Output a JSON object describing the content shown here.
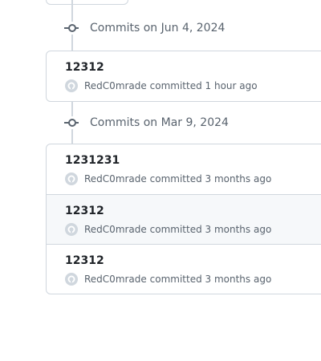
{
  "groups": [
    {
      "header": "Commits on Jun 4, 2024",
      "commits": [
        {
          "title": "12312",
          "author": "RedC0mrade",
          "action": "committed",
          "time": "1 hour ago"
        }
      ]
    },
    {
      "header": "Commits on Mar 9, 2024",
      "commits": [
        {
          "title": "1231231",
          "author": "RedC0mrade",
          "action": "committed",
          "time": "3 months ago"
        },
        {
          "title": "12312",
          "author": "RedC0mrade",
          "action": "committed",
          "time": "3 months ago",
          "highlighted": true
        },
        {
          "title": "12312",
          "author": "RedC0mrade",
          "action": "committed",
          "time": "3 months ago"
        }
      ]
    }
  ],
  "colors": {
    "border": "#d0d7de",
    "muted_text": "#59636e",
    "primary_text": "#1f2328",
    "row_highlight": "#f6f8fa"
  },
  "icons": {
    "group_header": "git-commit-icon",
    "author_avatar": "github-avatar-icon"
  }
}
